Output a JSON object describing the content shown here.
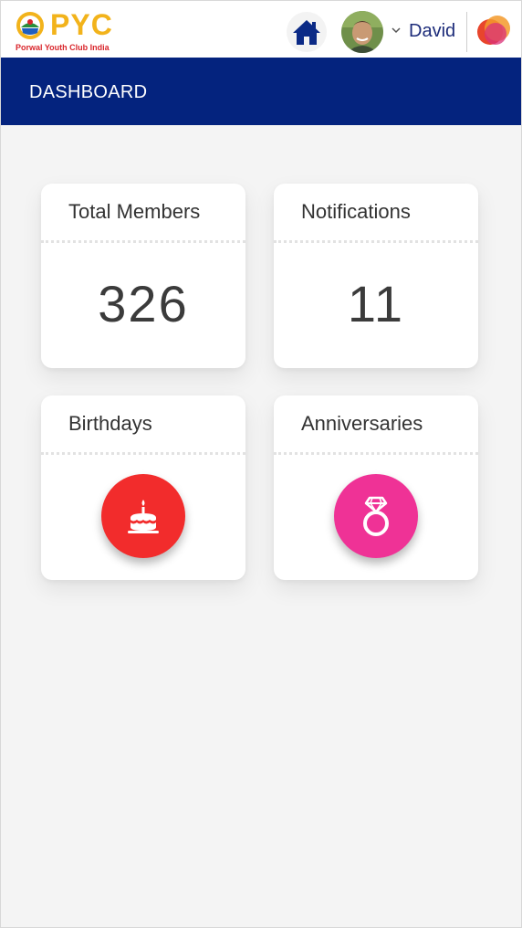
{
  "header": {
    "logo_text": "PYC",
    "logo_subtext": "Porwal Youth Club India",
    "user_name": "David"
  },
  "titlebar": {
    "title": "DASHBOARD"
  },
  "cards": {
    "total_members": {
      "title": "Total Members",
      "value": "326"
    },
    "notifications": {
      "title": "Notifications",
      "value": "11"
    },
    "birthdays": {
      "title": "Birthdays",
      "icon": "cake-icon",
      "color": "#f22c2c"
    },
    "anniversaries": {
      "title": "Anniversaries",
      "icon": "ring-icon",
      "color": "#ef3296"
    }
  },
  "colors": {
    "header_blue": "#04237e",
    "logo_yellow": "#f2b31b",
    "logo_red": "#d9262c",
    "name_blue": "#1d2c7a"
  },
  "icons": {
    "home": "home-icon",
    "dropdown": "chevron-down-icon",
    "brand": "brand-icon"
  }
}
